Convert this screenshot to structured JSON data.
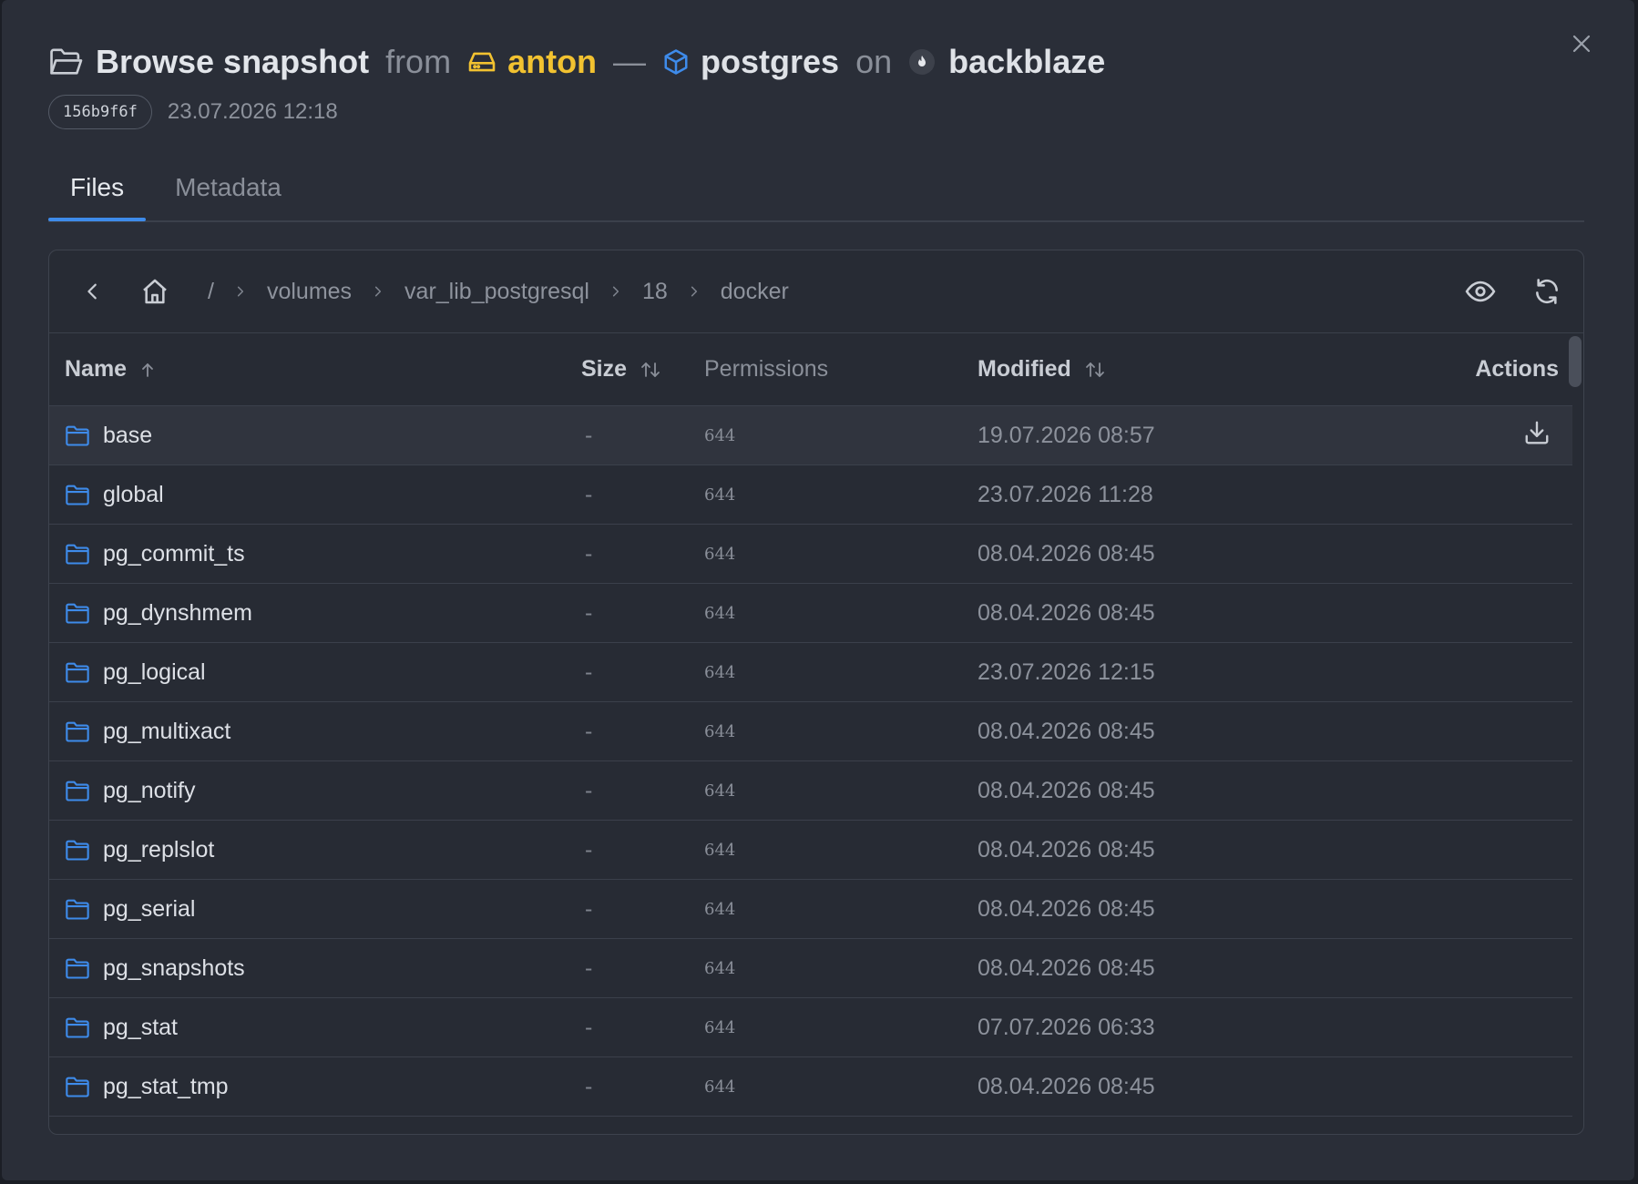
{
  "header": {
    "title": "Browse snapshot",
    "from_word": "from",
    "host": "anton",
    "dash": "—",
    "service": "postgres",
    "on_word": "on",
    "repo": "backblaze",
    "snapshot_id": "156b9f6f",
    "snapshot_date": "23.07.2026 12:18"
  },
  "tabs": [
    {
      "label": "Files",
      "active": true
    },
    {
      "label": "Metadata",
      "active": false
    }
  ],
  "breadcrumb": {
    "root": "/",
    "segments": [
      "volumes",
      "var_lib_postgresql",
      "18",
      "docker"
    ]
  },
  "columns": {
    "name": "Name",
    "size": "Size",
    "permissions": "Permissions",
    "modified": "Modified",
    "actions": "Actions"
  },
  "rows": [
    {
      "name": "base",
      "size": "-",
      "perm": "644",
      "modified": "19.07.2026 08:57"
    },
    {
      "name": "global",
      "size": "-",
      "perm": "644",
      "modified": "23.07.2026 11:28"
    },
    {
      "name": "pg_commit_ts",
      "size": "-",
      "perm": "644",
      "modified": "08.04.2026 08:45"
    },
    {
      "name": "pg_dynshmem",
      "size": "-",
      "perm": "644",
      "modified": "08.04.2026 08:45"
    },
    {
      "name": "pg_logical",
      "size": "-",
      "perm": "644",
      "modified": "23.07.2026 12:15"
    },
    {
      "name": "pg_multixact",
      "size": "-",
      "perm": "644",
      "modified": "08.04.2026 08:45"
    },
    {
      "name": "pg_notify",
      "size": "-",
      "perm": "644",
      "modified": "08.04.2026 08:45"
    },
    {
      "name": "pg_replslot",
      "size": "-",
      "perm": "644",
      "modified": "08.04.2026 08:45"
    },
    {
      "name": "pg_serial",
      "size": "-",
      "perm": "644",
      "modified": "08.04.2026 08:45"
    },
    {
      "name": "pg_snapshots",
      "size": "-",
      "perm": "644",
      "modified": "08.04.2026 08:45"
    },
    {
      "name": "pg_stat",
      "size": "-",
      "perm": "644",
      "modified": "07.07.2026 06:33"
    },
    {
      "name": "pg_stat_tmp",
      "size": "-",
      "perm": "644",
      "modified": "08.04.2026 08:45"
    }
  ],
  "colors": {
    "accent": "#3e8bea",
    "host": "#f2c230",
    "folder": "#3e8bea"
  },
  "icons": {
    "title": "folder-open-icon",
    "host": "hard-drive-icon",
    "service": "box-icon",
    "repo": "flame-icon",
    "close": "close-icon",
    "back": "chevron-left-icon",
    "home": "home-icon",
    "preview": "eye-icon",
    "refresh": "refresh-icon",
    "download": "download-icon",
    "row": "folder-icon"
  }
}
